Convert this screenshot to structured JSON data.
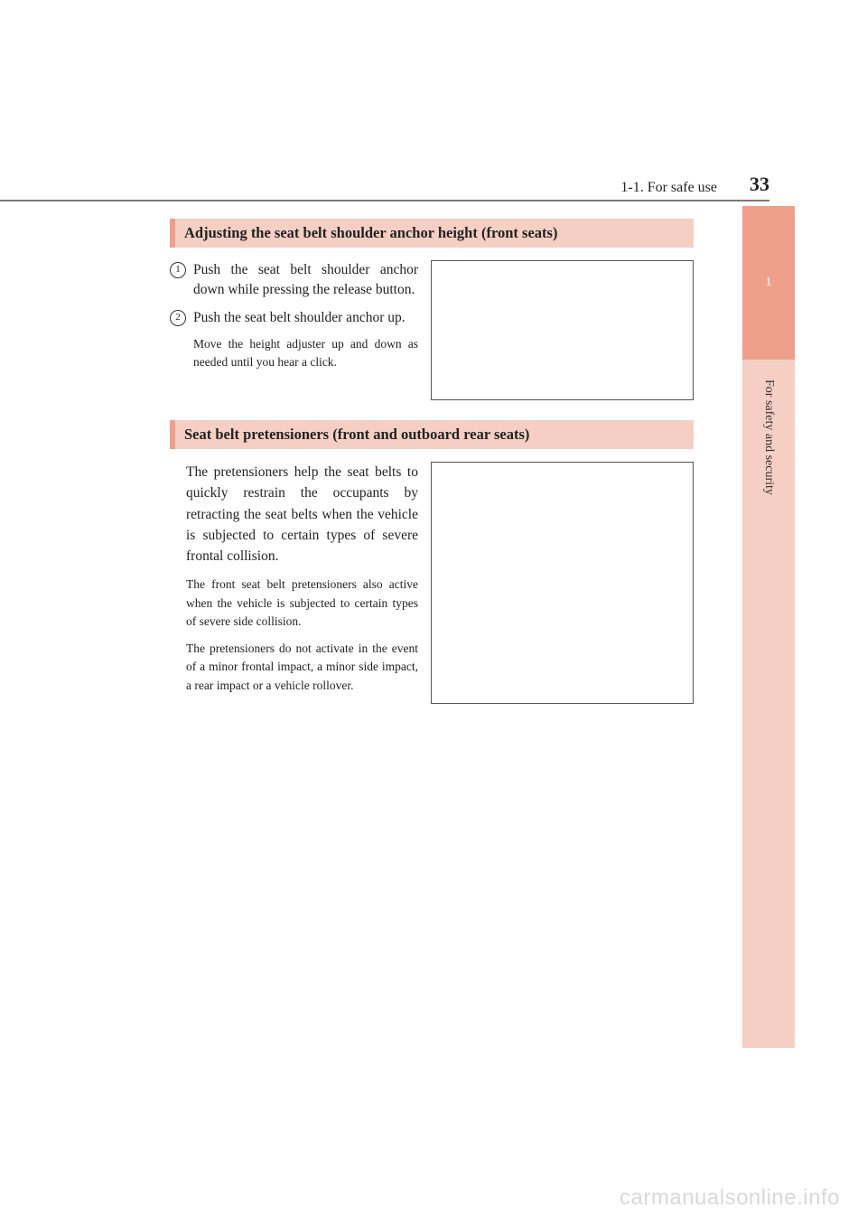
{
  "header": {
    "section": "1-1. For safe use",
    "page_number": "33"
  },
  "side": {
    "chapter_number": "1",
    "chapter_title": "For safety and security"
  },
  "section1": {
    "heading": "Adjusting the seat belt shoulder anchor height (front seats)",
    "items": [
      {
        "num": "1",
        "text": "Push the seat belt shoulder anchor down while pressing the release button."
      },
      {
        "num": "2",
        "text": "Push the seat belt shoulder anchor up."
      }
    ],
    "note": "Move the height adjuster up and down as needed until you hear a click."
  },
  "section2": {
    "heading": "Seat belt pretensioners (front and outboard rear seats)",
    "para": "The pretensioners help the seat belts to quickly restrain the occupants by retracting the seat belts when the vehicle is subjected to certain types of severe frontal collision.",
    "note1": "The front seat belt pretensioners also active when the vehicle is subjected to certain types of severe side collision.",
    "note2": "The pretensioners do not activate in the event of a minor frontal impact, a minor side impact, a rear impact or a vehicle rollover."
  },
  "watermark": "carmanualsonline.info"
}
